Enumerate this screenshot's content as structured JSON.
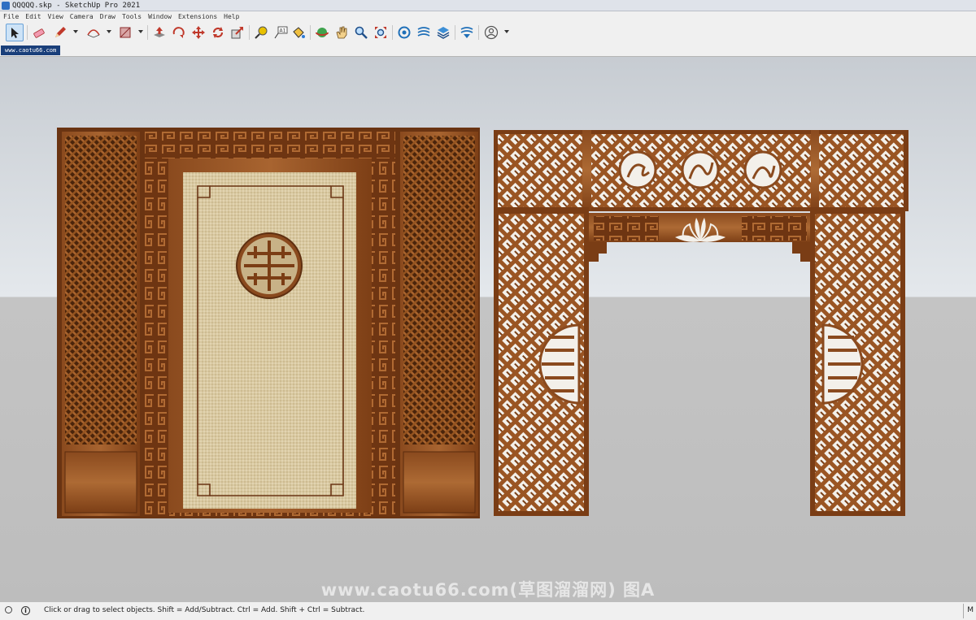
{
  "window": {
    "title": "QQQQQ.skp - SketchUp Pro 2021"
  },
  "menu": [
    "File",
    "Edit",
    "View",
    "Camera",
    "Draw",
    "Tools",
    "Window",
    "Extensions",
    "Help"
  ],
  "toolbar": {
    "tools": [
      {
        "name": "select",
        "icon": "arrow-cursor-icon",
        "active": true
      },
      {
        "name": "eraser",
        "icon": "eraser-icon"
      },
      {
        "name": "line",
        "icon": "pencil-icon",
        "dropdown": true
      },
      {
        "name": "arc",
        "icon": "arc-icon",
        "dropdown": true
      },
      {
        "name": "rectangle",
        "icon": "rectangle-icon",
        "dropdown": true
      },
      {
        "name": "push-pull",
        "icon": "push-pull-icon"
      },
      {
        "name": "move",
        "icon": "move-arrows-icon"
      },
      {
        "name": "rotate",
        "icon": "rotate-icon"
      },
      {
        "name": "scale",
        "icon": "scale-icon"
      },
      {
        "name": "offset",
        "icon": "offset-icon"
      },
      {
        "name": "tape-measure",
        "icon": "tape-measure-icon"
      },
      {
        "name": "text",
        "icon": "text-label-icon"
      },
      {
        "name": "paint-bucket",
        "icon": "paint-bucket-icon"
      },
      {
        "name": "orbit",
        "icon": "orbit-icon"
      },
      {
        "name": "pan",
        "icon": "hand-icon"
      },
      {
        "name": "zoom",
        "icon": "magnifier-icon"
      },
      {
        "name": "zoom-extents",
        "icon": "zoom-extents-icon"
      },
      {
        "name": "3d-warehouse",
        "icon": "warehouse-icon"
      },
      {
        "name": "extension-warehouse",
        "icon": "extension-icon"
      },
      {
        "name": "layout",
        "icon": "layout-icon"
      },
      {
        "name": "extension-manager",
        "icon": "extension-manager-icon"
      },
      {
        "name": "account",
        "icon": "user-account-icon",
        "dropdown": true
      }
    ]
  },
  "scene_tab": {
    "label": "www.caotu66.com"
  },
  "watermark": {
    "text": "www.caotu66.com(草图溜溜网) 图A"
  },
  "status": {
    "text": "Click or drag to select objects. Shift = Add/Subtract. Ctrl = Add. Shift + Ctrl = Subtract.",
    "measurements_label": "M"
  },
  "colors": {
    "wood": "#8a4a1e",
    "wood_dark": "#5e2f10",
    "wood_light": "#a86430",
    "panel_fill": "#d8c8a0",
    "accent": "#1a3f7a"
  }
}
